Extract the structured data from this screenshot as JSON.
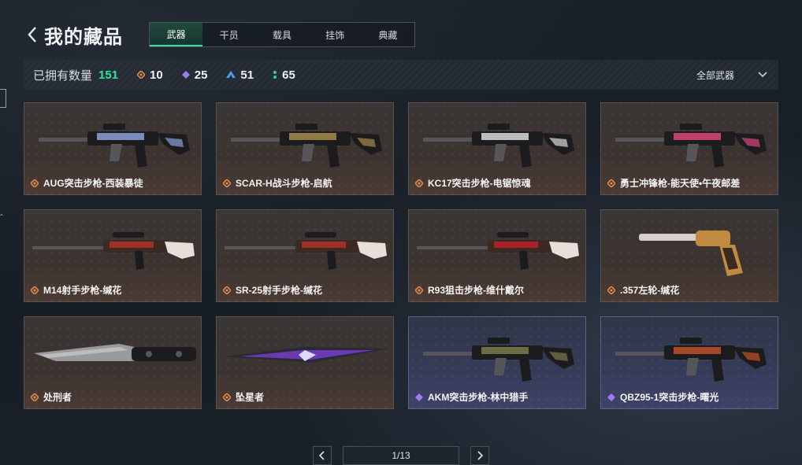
{
  "header": {
    "title": "我的藏品",
    "back_icon": "chevron-left-icon"
  },
  "tabs": [
    {
      "label": "武器",
      "active": true
    },
    {
      "label": "干员",
      "active": false
    },
    {
      "label": "载具",
      "active": false
    },
    {
      "label": "挂饰",
      "active": false
    },
    {
      "label": "典藏",
      "active": false
    }
  ],
  "stats": {
    "owned_label": "已拥有数量",
    "owned_count": "151",
    "rarities": [
      {
        "icon": "orange-diamond-icon",
        "color": "#e0894b",
        "count": "10"
      },
      {
        "icon": "purple-diamond-icon",
        "color": "#9b7df0",
        "count": "25"
      },
      {
        "icon": "blue-triangle-icon",
        "color": "#4a9ee8",
        "count": "51"
      },
      {
        "icon": "green-dots-icon",
        "color": "#30d48c",
        "count": "65"
      }
    ],
    "filter_label": "全部武器"
  },
  "items": [
    {
      "name": "AUG突击步枪-西装暴徒",
      "rarity": "orange",
      "kind": "rifle",
      "accent": "#8aa0d8"
    },
    {
      "name": "SCAR-H战斗步枪-启航",
      "rarity": "orange",
      "kind": "rifle",
      "accent": "#a58a4a"
    },
    {
      "name": "KC17突击步枪-电锯惊魂",
      "rarity": "orange",
      "kind": "rifle",
      "accent": "#d8d8d8"
    },
    {
      "name": "勇士冲锋枪-能天使•午夜邮差",
      "rarity": "orange",
      "kind": "smg",
      "accent": "#d8457a"
    },
    {
      "name": "M14射手步枪-缄花",
      "rarity": "orange",
      "kind": "long",
      "accent": "#b0302a"
    },
    {
      "name": "SR-25射手步枪-缄花",
      "rarity": "orange",
      "kind": "long",
      "accent": "#b0302a"
    },
    {
      "name": "R93狙击步枪-维什戴尔",
      "rarity": "orange",
      "kind": "long",
      "accent": "#c0202a"
    },
    {
      "name": ".357左轮-缄花",
      "rarity": "orange",
      "kind": "pistol",
      "accent": "#c08a40"
    },
    {
      "name": "处刑者",
      "rarity": "orange",
      "kind": "knife",
      "accent": "#bdbdbd"
    },
    {
      "name": "坠星者",
      "rarity": "orange",
      "kind": "blade",
      "accent": "#7a3fd0"
    },
    {
      "name": "AKM突击步枪-林中猎手",
      "rarity": "purple",
      "kind": "rifle",
      "accent": "#7a7a4a"
    },
    {
      "name": "QBZ95-1突击步枪-曙光",
      "rarity": "purple",
      "kind": "rifle",
      "accent": "#c0502a"
    }
  ],
  "pager": {
    "page": "1/13",
    "prev_icon": "chevron-left-icon",
    "next_icon": "chevron-right-icon"
  },
  "colors": {
    "accent_green": "#30e39b",
    "rarity_orange": "#e0894b",
    "rarity_purple": "#9b7df0"
  }
}
